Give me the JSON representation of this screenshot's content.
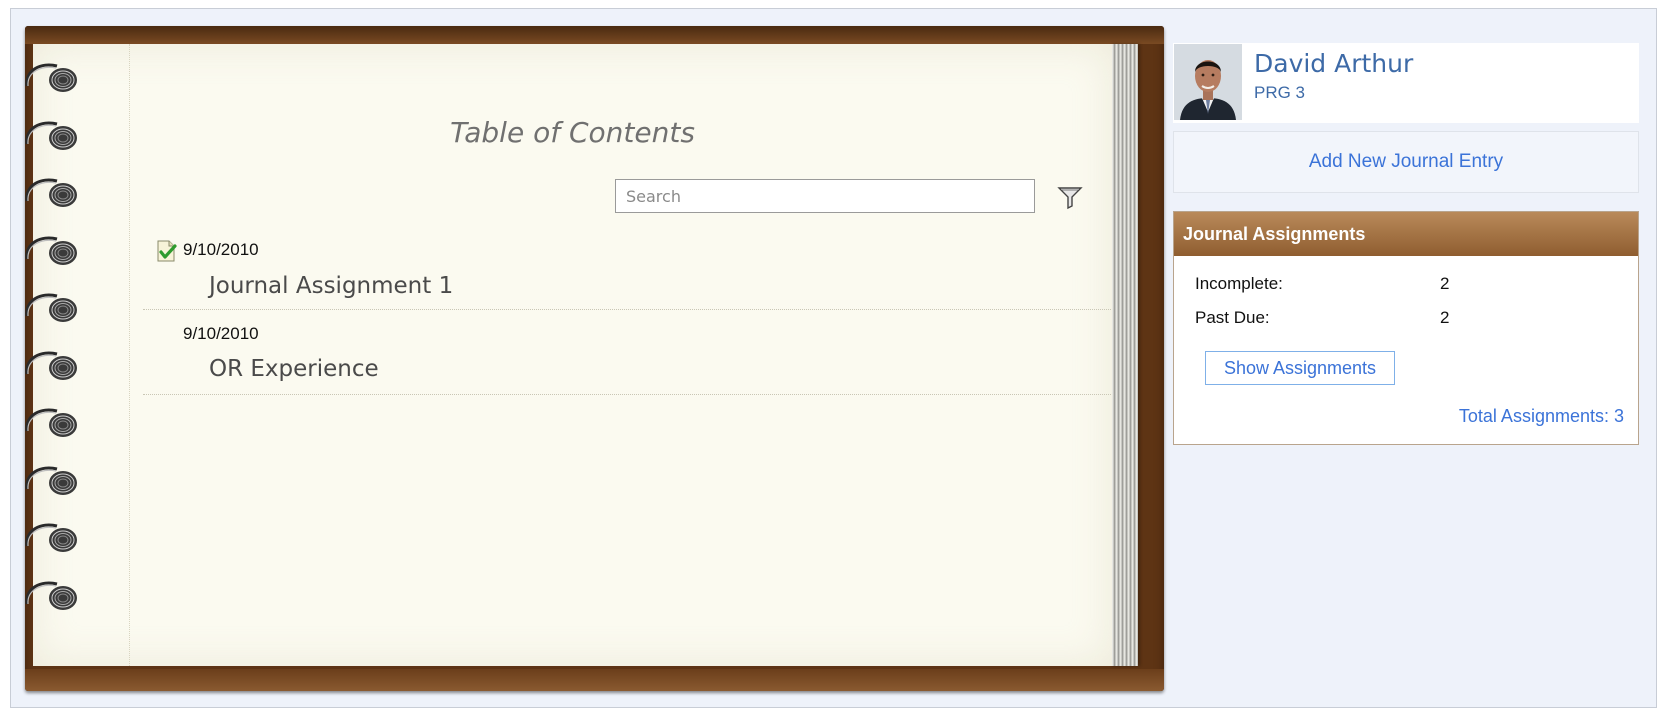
{
  "notebook": {
    "title": "Table of Contents",
    "search": {
      "placeholder": "Search",
      "value": ""
    },
    "filter_icon": "filter-funnel-icon",
    "entries": [
      {
        "date": "9/10/2010",
        "title": "Journal Assignment 1",
        "status_icon": "completed-check-icon"
      },
      {
        "date": "9/10/2010",
        "title": "OR Experience",
        "status_icon": ""
      }
    ]
  },
  "profile": {
    "name": "David Arthur",
    "program": "PRG 3"
  },
  "actions": {
    "add_entry_label": "Add New Journal Entry"
  },
  "assignments": {
    "header": "Journal Assignments",
    "incomplete_label": "Incomplete:",
    "incomplete_value": "2",
    "past_due_label": "Past Due:",
    "past_due_value": "2",
    "show_button": "Show Assignments",
    "total_label": "Total Assignments: 3"
  },
  "colors": {
    "link_blue": "#3b73d8",
    "name_blue": "#3d6aa7",
    "header_brown": "#9b6a3c",
    "cover_brown": "#5e3414",
    "paper": "#fbfaf0"
  }
}
